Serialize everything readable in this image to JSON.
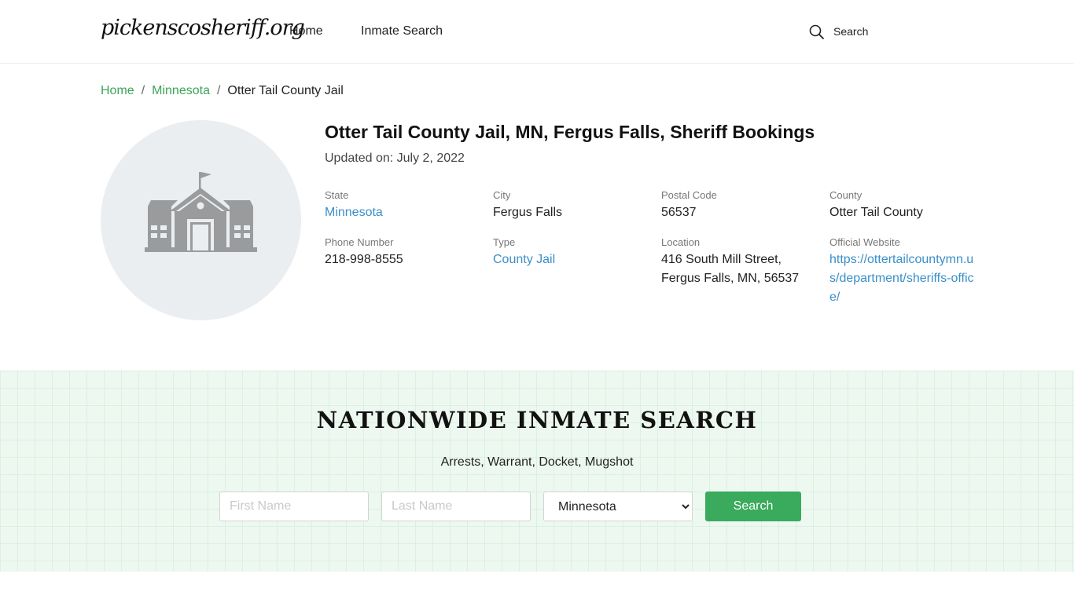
{
  "header": {
    "logo_text": "pickenscosheriff.org",
    "nav": {
      "home": "Home",
      "inmate_search": "Inmate Search"
    },
    "search_label": "Search",
    "search_icon": "search-icon"
  },
  "breadcrumb": {
    "items": [
      {
        "label": "Home"
      },
      {
        "label": "Minnesota"
      },
      {
        "label": "Otter Tail County Jail"
      }
    ],
    "separator": "/"
  },
  "facility": {
    "image_icon": "school-building-icon",
    "title": "Otter Tail County Jail, MN, Fergus Falls, Sheriff Bookings",
    "updated": "Updated on: July 2, 2022",
    "info": {
      "state": {
        "label": "State",
        "value": "Minnesota"
      },
      "city": {
        "label": "City",
        "value": "Fergus Falls"
      },
      "postal_code": {
        "label": "Postal Code",
        "value": "56537"
      },
      "county": {
        "label": "County",
        "value": "Otter Tail County"
      },
      "phone": {
        "label": "Phone Number",
        "value": "218-998-8555"
      },
      "type": {
        "label": "Type",
        "value": "County Jail"
      },
      "location": {
        "label": "Location",
        "line1": "416 South Mill Street,",
        "line2": "Fergus Falls, MN, 56537"
      },
      "website": {
        "label": "Official Website",
        "value": "https://ottertailcountymn.us/department/sheriffs-office/"
      }
    }
  },
  "nationwide_search": {
    "title": "NATIONWIDE INMATE SEARCH",
    "subtitle": "Arrests, Warrant, Docket, Mugshot",
    "first_name_placeholder": "First Name",
    "last_name_placeholder": "Last Name",
    "state_selected": "Minnesota",
    "button_label": "Search"
  },
  "colors": {
    "link_green": "#3aa55a",
    "link_blue": "#3a8fc8",
    "button_green": "#3aaa5c",
    "band_background": "#edf8f0",
    "image_circle": "#ebeef1",
    "building_gray": "#9a9b9d"
  }
}
